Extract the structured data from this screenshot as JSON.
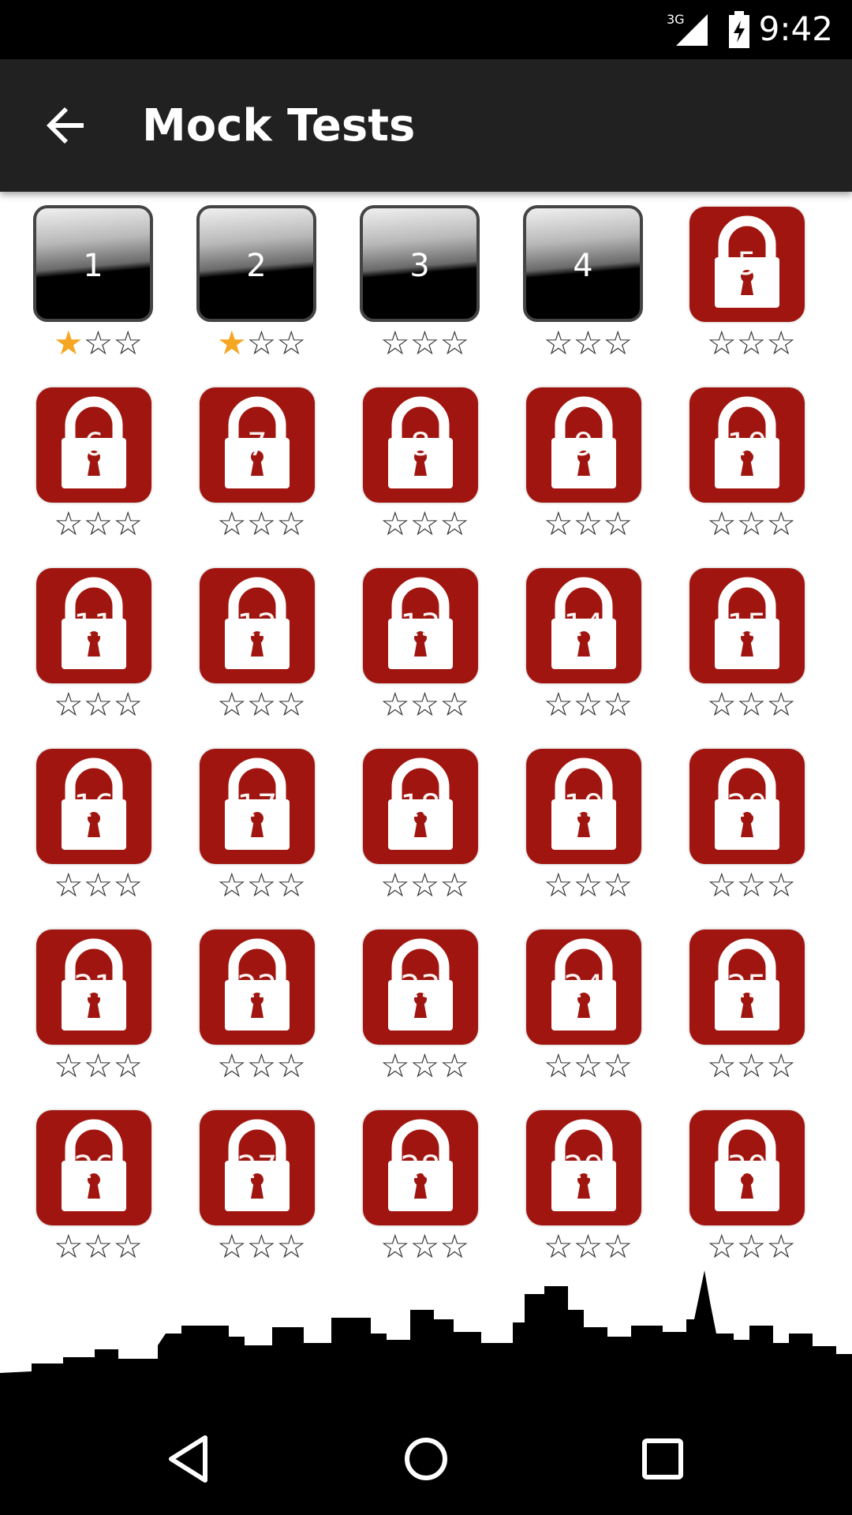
{
  "status_bar": {
    "time": "9:42",
    "network": "3G"
  },
  "app_bar": {
    "title": "Mock Tests"
  },
  "tests": [
    {
      "num": "1",
      "locked": false,
      "stars": 1
    },
    {
      "num": "2",
      "locked": false,
      "stars": 1
    },
    {
      "num": "3",
      "locked": false,
      "stars": 0
    },
    {
      "num": "4",
      "locked": false,
      "stars": 0
    },
    {
      "num": "5",
      "locked": true,
      "stars": 0
    },
    {
      "num": "6",
      "locked": true,
      "stars": 0
    },
    {
      "num": "7",
      "locked": true,
      "stars": 0
    },
    {
      "num": "8",
      "locked": true,
      "stars": 0
    },
    {
      "num": "9",
      "locked": true,
      "stars": 0
    },
    {
      "num": "10",
      "locked": true,
      "stars": 0
    },
    {
      "num": "11",
      "locked": true,
      "stars": 0
    },
    {
      "num": "12",
      "locked": true,
      "stars": 0
    },
    {
      "num": "13",
      "locked": true,
      "stars": 0
    },
    {
      "num": "14",
      "locked": true,
      "stars": 0
    },
    {
      "num": "15",
      "locked": true,
      "stars": 0
    },
    {
      "num": "16",
      "locked": true,
      "stars": 0
    },
    {
      "num": "17",
      "locked": true,
      "stars": 0
    },
    {
      "num": "18",
      "locked": true,
      "stars": 0
    },
    {
      "num": "19",
      "locked": true,
      "stars": 0
    },
    {
      "num": "20",
      "locked": true,
      "stars": 0
    },
    {
      "num": "21",
      "locked": true,
      "stars": 0
    },
    {
      "num": "22",
      "locked": true,
      "stars": 0
    },
    {
      "num": "23",
      "locked": true,
      "stars": 0
    },
    {
      "num": "24",
      "locked": true,
      "stars": 0
    },
    {
      "num": "25",
      "locked": true,
      "stars": 0
    },
    {
      "num": "26",
      "locked": true,
      "stars": 0
    },
    {
      "num": "27",
      "locked": true,
      "stars": 0
    },
    {
      "num": "28",
      "locked": true,
      "stars": 0
    },
    {
      "num": "29",
      "locked": true,
      "stars": 0
    },
    {
      "num": "30",
      "locked": true,
      "stars": 0
    }
  ],
  "max_stars": 3,
  "colors": {
    "lock_red": "#a0150f",
    "star_gold": "#f5a623",
    "app_bar": "#212121"
  },
  "icons": {
    "back": "arrow-left-icon",
    "lock": "padlock-icon",
    "nav": [
      "back-triangle-icon",
      "home-circle-icon",
      "recents-square-icon"
    ]
  }
}
